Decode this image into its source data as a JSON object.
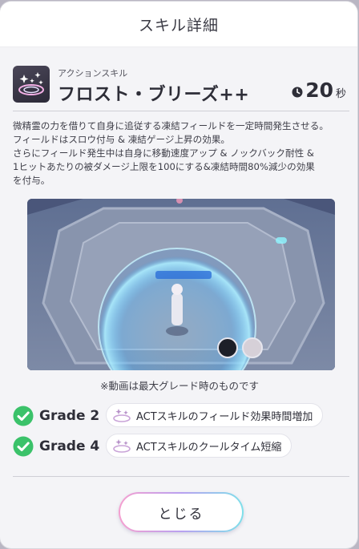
{
  "dialog": {
    "title": "スキル詳細"
  },
  "skill": {
    "type": "アクションスキル",
    "name": "フロスト・ブリーズ++",
    "cooldown_value": "20",
    "cooldown_unit": "秒",
    "description": "微精霊の力を借りて自身に追従する凍結フィールドを一定時間発生させる。\nフィールドはスロウ付与 & 凍結ゲージ上昇の効果。\nさらにフィールド発生中は自身に移動速度アップ & ノックバック耐性 &\n1ヒットあたりの被ダメージ上限を100にする&凍結時間80%減少の効果\nを付与。"
  },
  "video": {
    "note": "※動画は最大グレード時のものです"
  },
  "grades": [
    {
      "label": "Grade 2",
      "effect": "ACTスキルのフィールド効果時間増加"
    },
    {
      "label": "Grade 4",
      "effect": "ACTスキルのクールタイム短縮"
    }
  ],
  "actions": {
    "close_label": "とじる"
  },
  "colors": {
    "check_green": "#3bc26a",
    "accent_gradient": [
      "#f5a0d0",
      "#b9a0f0",
      "#7fe0ea"
    ]
  }
}
